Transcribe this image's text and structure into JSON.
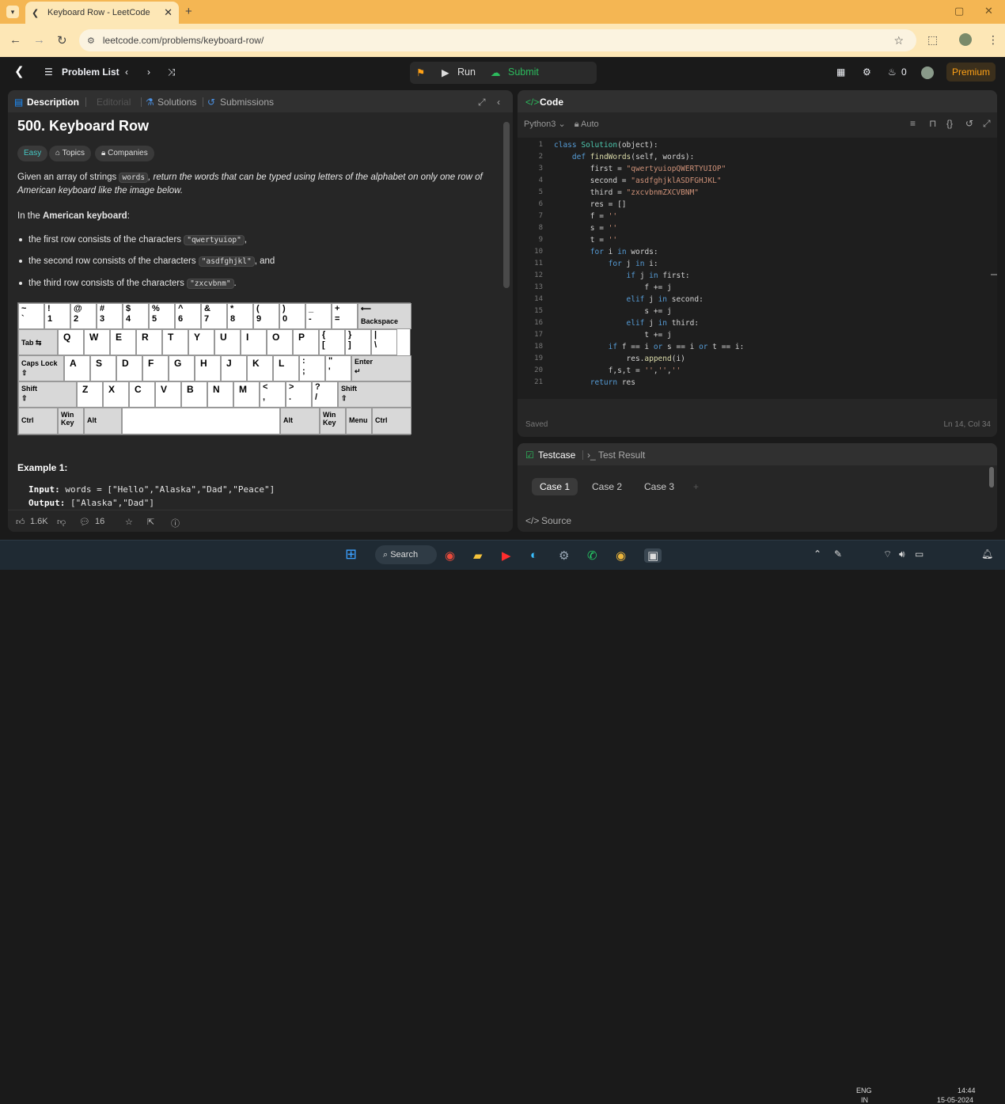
{
  "browser": {
    "tab_title": "Keyboard Row - LeetCode",
    "url": "leetcode.com/problems/keyboard-row/"
  },
  "nav": {
    "problem_list": "Problem List",
    "run": "Run",
    "submit": "Submit",
    "streak": "0",
    "premium": "Premium"
  },
  "desc": {
    "tabs": [
      "Description",
      "Editorial",
      "Solutions",
      "Submissions"
    ],
    "title": "500. Keyboard Row",
    "difficulty": "Easy",
    "chips": [
      "Topics",
      "Companies"
    ],
    "intro_a": "Given an array of strings ",
    "intro_code": "words",
    "intro_b": ", return the words that can be typed using letters of the alphabet on only one row of American keyboard like the image below.",
    "american_a": "In the ",
    "american_b": "American keyboard",
    "american_c": ":",
    "bullets": [
      {
        "pre": "the first row consists of the characters ",
        "code": "\"qwertyuiop\"",
        "post": ","
      },
      {
        "pre": "the second row consists of the characters ",
        "code": "\"asdfghjkl\"",
        "post": ", and"
      },
      {
        "pre": "the third row consists of the characters ",
        "code": "\"zxcvbnm\"",
        "post": "."
      }
    ],
    "keyboard": {
      "row1": [
        [
          "~",
          "`"
        ],
        [
          "!",
          "1"
        ],
        [
          "@",
          "2"
        ],
        [
          "#",
          "3"
        ],
        [
          "$",
          "4"
        ],
        [
          "%",
          "5"
        ],
        [
          "^",
          "6"
        ],
        [
          "&",
          "7"
        ],
        [
          "*",
          "8"
        ],
        [
          "(",
          "9"
        ],
        [
          ")",
          "0"
        ],
        [
          "_",
          "-"
        ],
        [
          "+",
          "="
        ]
      ],
      "backspace": "Backspace",
      "tab": "Tab",
      "row2": [
        "Q",
        "W",
        "E",
        "R",
        "T",
        "Y",
        "U",
        "I",
        "O",
        "P"
      ],
      "row2_sym": [
        [
          "{",
          "["
        ],
        [
          "}",
          "]"
        ],
        [
          "|",
          "\\"
        ]
      ],
      "caps": "Caps Lock",
      "row3": [
        "A",
        "S",
        "D",
        "F",
        "G",
        "H",
        "J",
        "K",
        "L"
      ],
      "row3_sym": [
        [
          ":",
          ";"
        ],
        [
          "\"",
          "'"
        ]
      ],
      "enter": "Enter",
      "shift": "Shift",
      "row4": [
        "Z",
        "X",
        "C",
        "V",
        "B",
        "N",
        "M"
      ],
      "row4_sym": [
        [
          "<",
          ","
        ],
        [
          ">",
          "."
        ],
        [
          "?",
          "/"
        ]
      ],
      "ctrl": "Ctrl",
      "win": "Win Key",
      "alt": "Alt",
      "menu": "Menu"
    },
    "example_label": "Example 1:",
    "input_label": "Input:",
    "input_value": "words = [\"Hello\",\"Alaska\",\"Dad\",\"Peace\"]",
    "output_label": "Output:",
    "output_value": "[\"Alaska\",\"Dad\"]",
    "likes": "1.6K",
    "comments": "16"
  },
  "code": {
    "title": "Code",
    "language": "Python3",
    "auto": "Auto",
    "saved": "Saved",
    "cursor": "Ln 14, Col 34",
    "lines": [
      "class Solution(object):",
      "    def findWords(self, words):",
      "        first = \"qwertyuiopQWERTYUIOP\"",
      "        second = \"asdfghjklASDFGHJKL\"",
      "        third = \"zxcvbnmZXCVBNM\"",
      "        res = []",
      "        f = ''",
      "        s = ''",
      "        t = ''",
      "        for i in words:",
      "            for j in i:",
      "                if j in first:",
      "                    f += j",
      "                elif j in second:",
      "                    s += j",
      "                elif j in third:",
      "                    t += j",
      "            if f == i or s == i or t == i:",
      "                res.append(i)",
      "            f,s,t = '','',''",
      "        return res"
    ]
  },
  "testcase": {
    "tabs": [
      "Testcase",
      "Test Result"
    ],
    "cases": [
      "Case 1",
      "Case 2",
      "Case 3"
    ],
    "source": "Source"
  },
  "taskbar": {
    "search": "Search",
    "lang": "ENG",
    "region": "IN",
    "time": "14:44",
    "date": "15-05-2024"
  }
}
